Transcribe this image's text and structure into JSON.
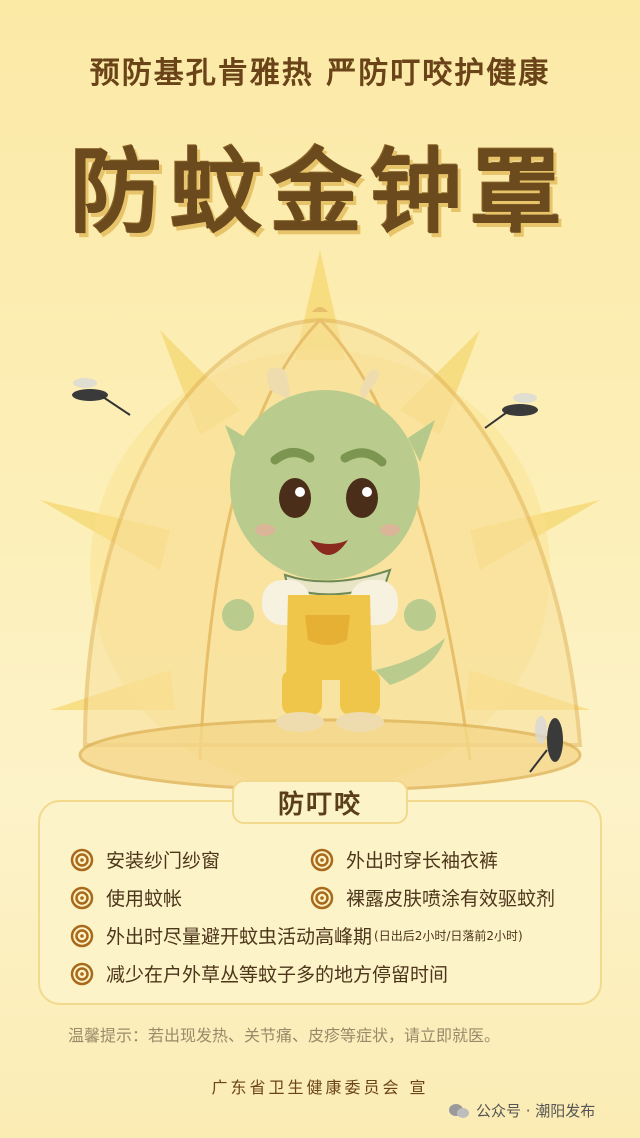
{
  "header": {
    "subtitle": "预防基孔肯雅热 严防叮咬护健康",
    "title": "防蚊金钟罩"
  },
  "section": {
    "heading": "防叮咬",
    "tips": [
      {
        "text": "安装纱门纱窗"
      },
      {
        "text": "外出时穿长袖衣裤"
      },
      {
        "text": "使用蚊帐"
      },
      {
        "text": "裸露皮肤喷涂有效驱蚊剂"
      },
      {
        "text": "外出时尽量避开蚊虫活动高峰期",
        "note": "(日出后2小时/日落前2小时)"
      },
      {
        "text": "减少在户外草丛等蚊子多的地方停留时间"
      }
    ]
  },
  "reminder": "温馨提示：若出现发热、关节痛、皮疹等症状，请立即就医。",
  "issuer": "广东省卫生健康委员会 宣",
  "watermark": "公众号 · 潮阳发布",
  "colors": {
    "title": "#6b4a1e",
    "card_bg": "#fdf3c8",
    "swirl": "#a86a1a",
    "dragon_green": "#b5c98a",
    "overalls": "#f0c64a"
  },
  "icons": [
    "swirl-icon",
    "mosquito-icon",
    "wechat-icon"
  ]
}
